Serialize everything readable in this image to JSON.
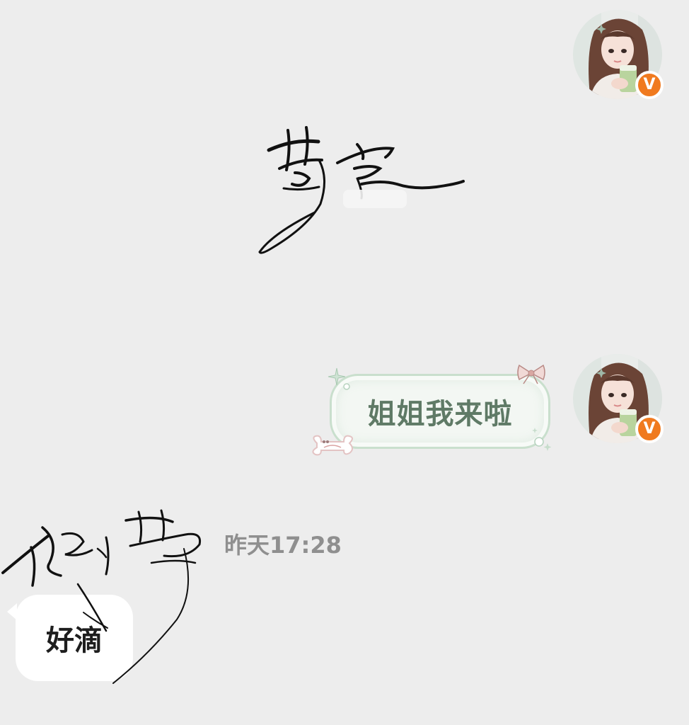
{
  "messages": [
    {
      "direction": "outgoing",
      "kind": "signature-sticker",
      "avatar_icon": "user-avatar-icon",
      "verified_icon": "verified-v-icon"
    },
    {
      "direction": "outgoing",
      "kind": "text",
      "text": "姐姐我来啦",
      "bubble_style": "green-floral-frame",
      "avatar_icon": "user-avatar-icon",
      "verified_icon": "verified-v-icon"
    },
    {
      "direction": "incoming",
      "kind": "text",
      "text": "好滴",
      "timestamp": "昨天17:28"
    }
  ],
  "badge": {
    "verified_letter": "V"
  },
  "colors": {
    "background": "#ededed",
    "incoming_bubble": "#ffffff",
    "outgoing_bubble_fill": "#f3f7f3",
    "outgoing_bubble_border": "#c9dfcd",
    "outgoing_text": "#5f7a66",
    "timestamp_text": "#8f8f8f",
    "verified_badge": "#f07a1f"
  }
}
